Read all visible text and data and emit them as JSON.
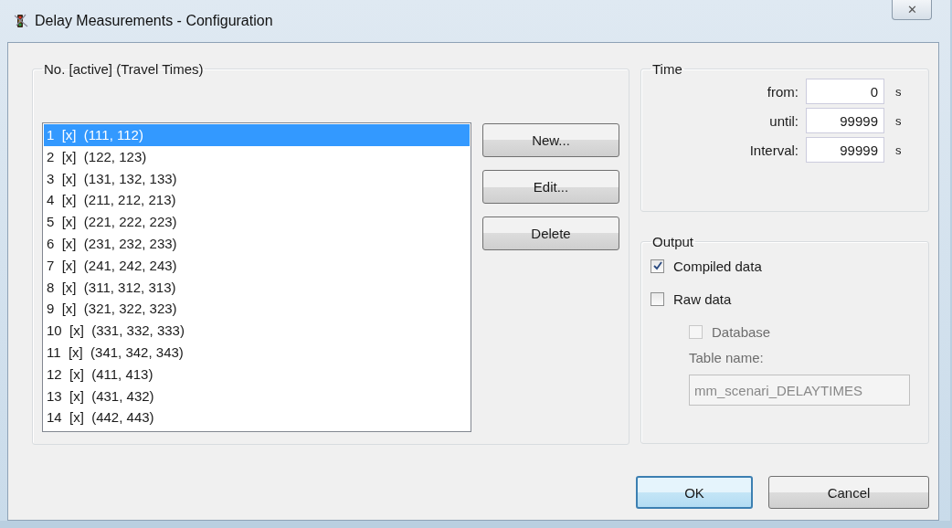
{
  "window": {
    "title": "Delay Measurements - Configuration",
    "close": "✕"
  },
  "list_group": {
    "title": "No. [active] (Travel Times)",
    "items": [
      {
        "label": "1  [x]  (111, 112)",
        "selected": true
      },
      {
        "label": "2  [x]  (122, 123)",
        "selected": false
      },
      {
        "label": "3  [x]  (131, 132, 133)",
        "selected": false
      },
      {
        "label": "4  [x]  (211, 212, 213)",
        "selected": false
      },
      {
        "label": "5  [x]  (221, 222, 223)",
        "selected": false
      },
      {
        "label": "6  [x]  (231, 232, 233)",
        "selected": false
      },
      {
        "label": "7  [x]  (241, 242, 243)",
        "selected": false
      },
      {
        "label": "8  [x]  (311, 312, 313)",
        "selected": false
      },
      {
        "label": "9  [x]  (321, 322, 323)",
        "selected": false
      },
      {
        "label": "10  [x]  (331, 332, 333)",
        "selected": false
      },
      {
        "label": "11  [x]  (341, 342, 343)",
        "selected": false
      },
      {
        "label": "12  [x]  (411, 413)",
        "selected": false
      },
      {
        "label": "13  [x]  (431, 432)",
        "selected": false
      },
      {
        "label": "14  [x]  (442, 443)",
        "selected": false
      }
    ],
    "buttons": [
      "New...",
      "Edit...",
      "Delete"
    ]
  },
  "time": {
    "title": "Time",
    "fields": [
      {
        "label": "from:",
        "value": "0",
        "unit": "s"
      },
      {
        "label": "until:",
        "value": "99999",
        "unit": "s"
      },
      {
        "label": "Interval:",
        "value": "99999",
        "unit": "s"
      }
    ]
  },
  "output": {
    "title": "Output",
    "checkboxes": [
      {
        "label": "Compiled data",
        "checked": true,
        "disabled": false
      },
      {
        "label": "Raw data",
        "checked": false,
        "disabled": false,
        "children": [
          {
            "label": "Database",
            "checked": false,
            "disabled": true
          }
        ]
      }
    ],
    "table_name": {
      "label": "Table name:",
      "value": "mm_scenari_DELAYTIMES",
      "disabled": true
    }
  },
  "buttons": [
    {
      "label": "OK",
      "default": true
    },
    {
      "label": "Cancel",
      "default": false
    }
  ]
}
